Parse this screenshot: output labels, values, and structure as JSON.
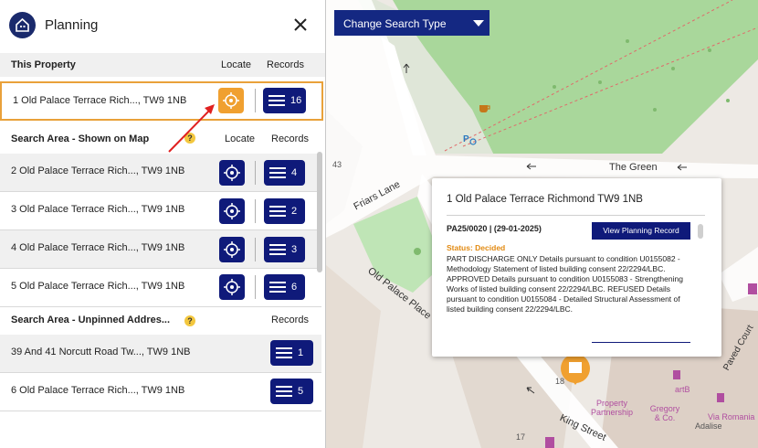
{
  "panel": {
    "title": "Planning",
    "this_property": {
      "heading": "This Property",
      "locate_label": "Locate",
      "records_label": "Records",
      "row": {
        "address": "1 Old Palace Terrace Rich..., TW9 1NB",
        "records": "16"
      }
    },
    "search_area": {
      "heading": "Search Area - Shown on Map",
      "help": "?",
      "locate_label": "Locate",
      "records_label": "Records",
      "rows": [
        {
          "address": "2 Old Palace Terrace Rich..., TW9 1NB",
          "records": "4"
        },
        {
          "address": "3 Old Palace Terrace Rich..., TW9 1NB",
          "records": "2"
        },
        {
          "address": "4 Old Palace Terrace Rich..., TW9 1NB",
          "records": "3"
        },
        {
          "address": "5 Old Palace Terrace Rich..., TW9 1NB",
          "records": "6"
        }
      ]
    },
    "unpinned": {
      "heading": "Search Area - Unpinned Addres...",
      "help": "?",
      "records_label": "Records",
      "rows": [
        {
          "address": "39 And 41 Norcutt Road Tw..., TW9 1NB",
          "records": "1"
        },
        {
          "address": "6 Old Palace Terrace Rich..., TW9 1NB",
          "records": "5"
        }
      ]
    }
  },
  "map": {
    "change_search_label": "Change Search Type",
    "labels": {
      "green": "The Green",
      "friars": "Friars Lane",
      "old_palace_place": "Old Palace Place",
      "king_street": "King Street",
      "paved_court": "Paved Court",
      "property_partnership": "Property Partnership",
      "gregory": "Gregory & Co.",
      "via_romania": "Via Romania",
      "adalise": "Adalise",
      "art": "artB",
      "n43": "43",
      "n18": "18",
      "n17": "17"
    },
    "popup": {
      "title": "1 Old Palace Terrace Richmond TW9 1NB",
      "ref": "PA25/0020 | (29-01-2025)",
      "view_button": "View Planning Record",
      "status": "Status: Decided",
      "description": "PART DISCHARGE ONLY Details pursuant to condition U0155082 - Methodology Statement of listed building consent 22/2294/LBC. APPROVED Details pursuant to condition U0155083 - Strengthening Works of listed building consent 22/2294/LBC. REFUSED Details pursuant to condition U0155084 - Detailed Structural Assessment of listed building consent 22/2294/LBC."
    }
  },
  "colors": {
    "navy": "#0f1a7a",
    "orange": "#f0a030",
    "park": "#9fd08f"
  }
}
